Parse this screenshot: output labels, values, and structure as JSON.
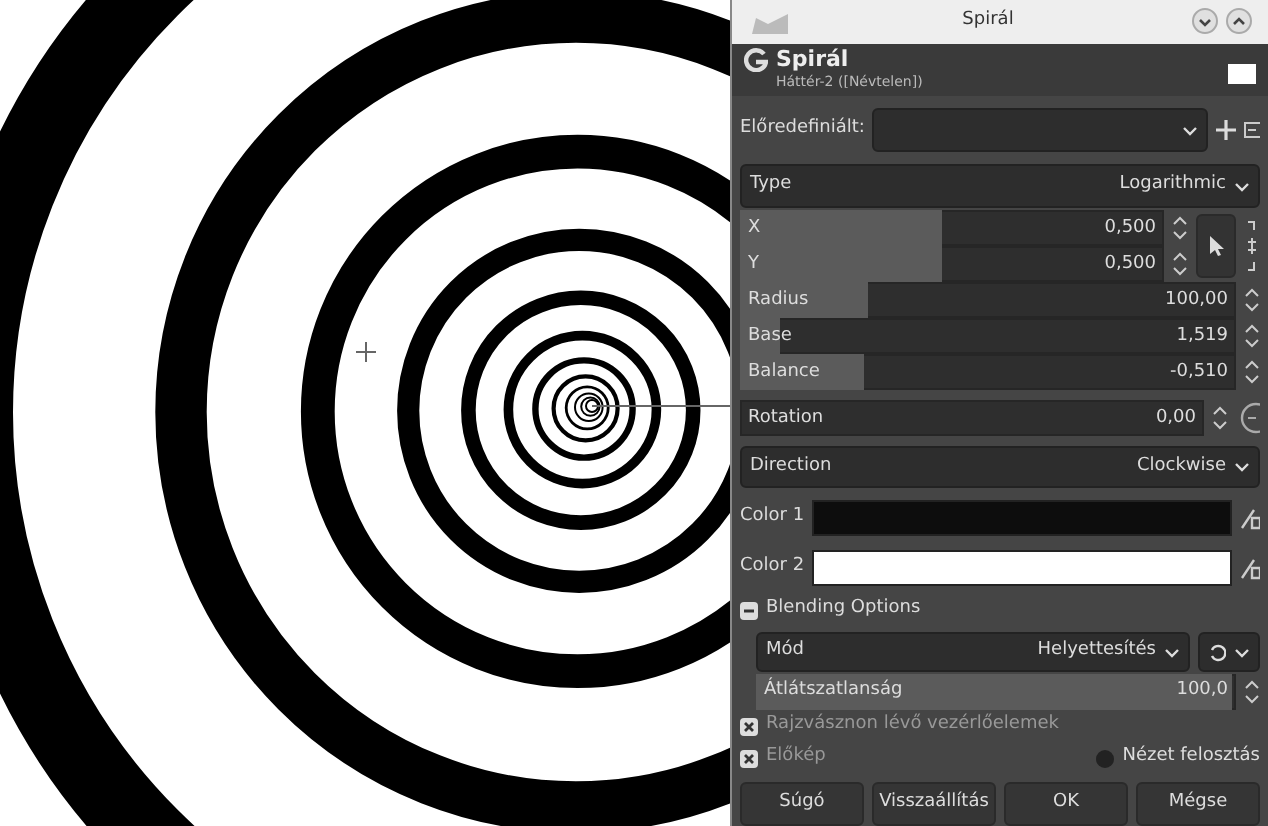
{
  "window": {
    "title": "Spirál"
  },
  "header": {
    "title": "Spirál",
    "subtitle": "Háttér-2 ([Névtelen])"
  },
  "presets": {
    "label": "Előredefiniált:"
  },
  "type": {
    "label": "Type",
    "value": "Logarithmic"
  },
  "sliders": [
    {
      "kind": "xy",
      "label": "X",
      "value": "0,500",
      "level": 0.48
    },
    {
      "kind": "xy",
      "label": "Y",
      "value": "0,500",
      "level": 0.48
    },
    {
      "kind": "plain",
      "label": "Radius",
      "value": "100,00",
      "level": 0.26
    },
    {
      "kind": "plain",
      "label": "Base",
      "value": "1,519",
      "level": 0.08
    },
    {
      "kind": "plain",
      "label": "Balance",
      "value": "-0,510",
      "level": 0.25
    },
    {
      "kind": "angle",
      "label": "Rotation",
      "value": "0,00",
      "level": 0
    }
  ],
  "direction": {
    "label": "Direction",
    "value": "Clockwise"
  },
  "colors": [
    {
      "label": "Color 1",
      "color": "#0d0d0d"
    },
    {
      "label": "Color 2",
      "color": "#ffffff"
    }
  ],
  "blending": {
    "label": "Blending Options",
    "expanded": true,
    "mode": {
      "label": "Mód",
      "value": "Helyettesítés"
    },
    "opacity": {
      "label": "Átlátszatlanság",
      "value": "100,0",
      "level": 1
    }
  },
  "options": [
    {
      "label": "Rajzvásznon lévő vezérlőelemek",
      "checked": true
    },
    {
      "label": "Előkép",
      "checked": true
    }
  ],
  "split_view": {
    "label": "Nézet felosztás",
    "checked": false
  },
  "buttons": [
    "Súgó",
    "Visszaállítás",
    "OK",
    "Mégse"
  ]
}
